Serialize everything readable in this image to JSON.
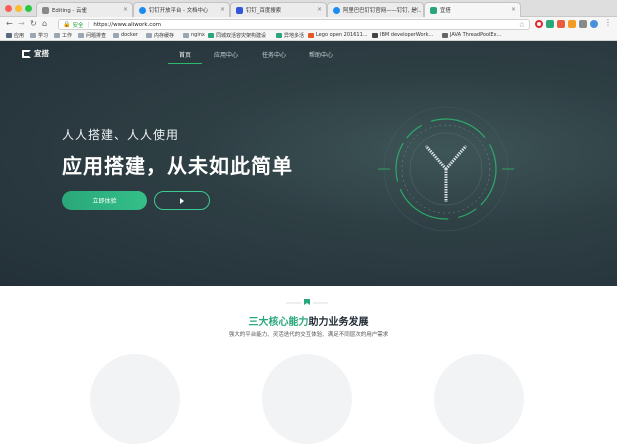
{
  "browser": {
    "tabs": [
      {
        "label": "Editing - 云雀",
        "active": false,
        "icon_color": "#888888"
      },
      {
        "label": "钉钉开放平台 - 文档中心",
        "active": false,
        "icon_color": "#1c8cf0"
      },
      {
        "label": "钉钉_百度搜索",
        "active": false,
        "icon_color": "#3257d8"
      },
      {
        "label": "阿里巴巴钉钉官网——钉钉, 是...",
        "active": false,
        "icon_color": "#1c8cf0"
      },
      {
        "label": "宜搭",
        "active": true,
        "icon_color": "#2aa77a"
      }
    ],
    "address": {
      "secure_label": "安全",
      "url": "https://www.aliwork.com"
    },
    "bookmarks": [
      "应用",
      "学习",
      "工作",
      "问题排查",
      "docker",
      "内存缓存",
      "nginx",
      "同城双活容灾架构建设",
      "异地多活",
      "Lego open 201611...",
      "IBM developerWork...",
      "JAVA ThreadPoolEx..."
    ]
  },
  "site": {
    "logo_text": "宜搭",
    "nav": [
      {
        "label": "首页",
        "active": true
      },
      {
        "label": "应用中心",
        "active": false
      },
      {
        "label": "任务中心",
        "active": false
      },
      {
        "label": "帮助中心",
        "active": false
      }
    ],
    "hero": {
      "subtitle": "人人搭建、人人使用",
      "title": "应用搭建，从未如此简单",
      "cta_label": "立即体验"
    },
    "section": {
      "title_highlight": "三大核心能力",
      "title_rest": "助力业务发展",
      "description": "强大的平台能力、灵活迭代的交互体验、满足不同层次的用户需求"
    }
  },
  "colors": {
    "accent": "#2aa77a",
    "hero_bg": "#2e3f44"
  }
}
